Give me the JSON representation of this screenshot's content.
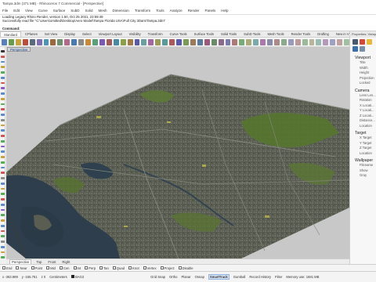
{
  "window": {
    "title": "Tampa.3dm (371 MB) - Rhinoceros 7 Commercial - [Perspective]"
  },
  "menu": [
    "File",
    "Edit",
    "View",
    "Curve",
    "Surface",
    "SubD",
    "Solid",
    "Mesh",
    "Dimension",
    "Transform",
    "Tools",
    "Analyze",
    "Render",
    "Panels",
    "Help"
  ],
  "command_history": [
    "Loading Legacy Rhino Render, version 1.50, Oct 25 2021, 23:59:49",
    "Successfully read file \"C:\\Users\\omitted\\Desktop\\Aero Model\\Tampa Florida USA\\Full City 3Dam\\Tampa.3dm\""
  ],
  "command_prompt": "Command:",
  "toolbar_tabs": [
    {
      "label": "Standard",
      "active": true
    },
    {
      "label": "CPlanes"
    },
    {
      "label": "Set View"
    },
    {
      "label": "Display"
    },
    {
      "label": "Select"
    },
    {
      "label": "Viewport Layout"
    },
    {
      "label": "Visibility"
    },
    {
      "label": "Transform"
    },
    {
      "label": "Curve Tools"
    },
    {
      "label": "Surface Tools"
    },
    {
      "label": "Solid Tools"
    },
    {
      "label": "SubD Tools"
    },
    {
      "label": "Mesh Tools"
    },
    {
      "label": "Render Tools"
    },
    {
      "label": "Drafting"
    },
    {
      "label": "New in V7"
    }
  ],
  "viewport": {
    "label": "Perspective"
  },
  "view_tabs": [
    {
      "label": "Perspective",
      "active": true
    },
    {
      "label": "Top"
    },
    {
      "label": "Front"
    },
    {
      "label": "Right"
    }
  ],
  "osnaps": [
    "End",
    "Near",
    "Point",
    "Mid",
    "Cen",
    "Int",
    "Perp",
    "Tan",
    "Quad",
    "Knot",
    "Vertex",
    "Project",
    "Disable"
  ],
  "status": {
    "x": "x -363.989",
    "y": "y -155.751",
    "z": "z 0",
    "units": "Centimeters",
    "layer": "BAG3",
    "grid_snap": "Grid Snap",
    "ortho": "Ortho",
    "planar": "Planar",
    "osnap": "Osnap",
    "smarttrack": "SmartTrack",
    "gumball": "Gumball",
    "record_history": "Record History",
    "filter": "Filter",
    "memory": "Memory use: 1681 MB"
  },
  "right_panel": {
    "header": "Properties: Viewport",
    "sections": [
      {
        "title": "Viewport",
        "rows": [
          "Title",
          "Width",
          "Height",
          "Projection",
          "Locked"
        ]
      },
      {
        "title": "Camera",
        "rows": [
          "Lens Len...",
          "Rotation",
          "X Locati...",
          "Y Locati...",
          "Z Locati...",
          "Distance...",
          "Location"
        ]
      },
      {
        "title": "Target",
        "rows": [
          "X Target",
          "Y Target",
          "Z Target",
          "Location"
        ]
      },
      {
        "title": "Wallpaper",
        "rows": [
          "Filename",
          "Show",
          "Gray"
        ]
      }
    ]
  },
  "colors": {
    "water": "#2e3e4c",
    "urban": "#5a5e52",
    "green": "#56752f",
    "viewport_bg": "#c8c8c8",
    "accent": "#2d6fd1"
  }
}
